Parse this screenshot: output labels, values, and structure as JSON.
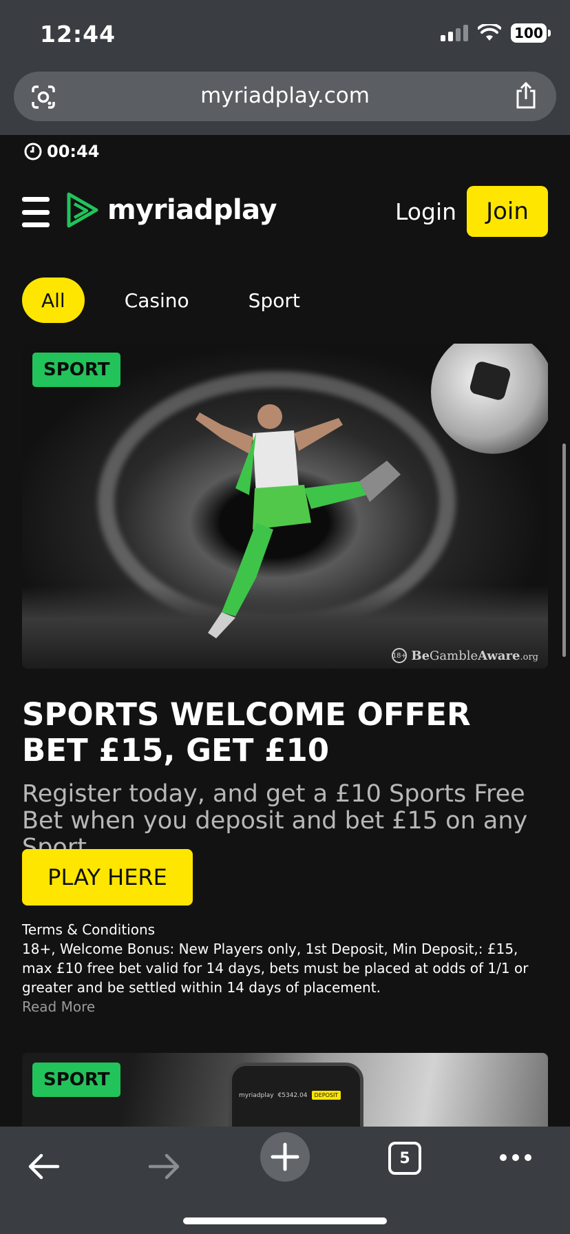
{
  "status_bar": {
    "time": "12:44",
    "battery": "100"
  },
  "browser": {
    "url": "myriadplay.com",
    "tab_count": "5"
  },
  "page": {
    "timer": "00:44",
    "header": {
      "logo_text": "myriadplay",
      "login_label": "Login",
      "join_label": "Join"
    },
    "filters": [
      "All",
      "Casino",
      "Sport"
    ],
    "active_filter": "All",
    "promo": {
      "badge": "SPORT",
      "gamble_aware_18": "18+",
      "gamble_aware_be": "Be",
      "gamble_aware_gamble": "Gamble",
      "gamble_aware_aware": "Aware",
      "gamble_aware_org": ".org",
      "title_line1": "SPORTS WELCOME OFFER",
      "title_line2": "BET £15, GET £10",
      "description": "Register today, and get a £10 Sports Free Bet when you deposit and bet £15 on any Sport.",
      "cta_label": "PLAY HERE",
      "terms_heading": "Terms & Conditions",
      "terms_body": "18+, Welcome Bonus: New Players only, 1st Deposit, Min Deposit,: £15, max £10 free bet valid for 14 days, bets must be placed at odds of 1/1 or greater and be settled within 14 days of placement.",
      "read_more": "Read More"
    },
    "second_promo": {
      "badge": "SPORT",
      "phone_logo": "myriadplay",
      "phone_balance": "€5342.04",
      "phone_deposit": "DEPOSIT"
    }
  },
  "colors": {
    "accent_yellow": "#ffe600",
    "brand_green": "#21c35a",
    "background": "#121212",
    "chrome": "#3a3d41"
  }
}
